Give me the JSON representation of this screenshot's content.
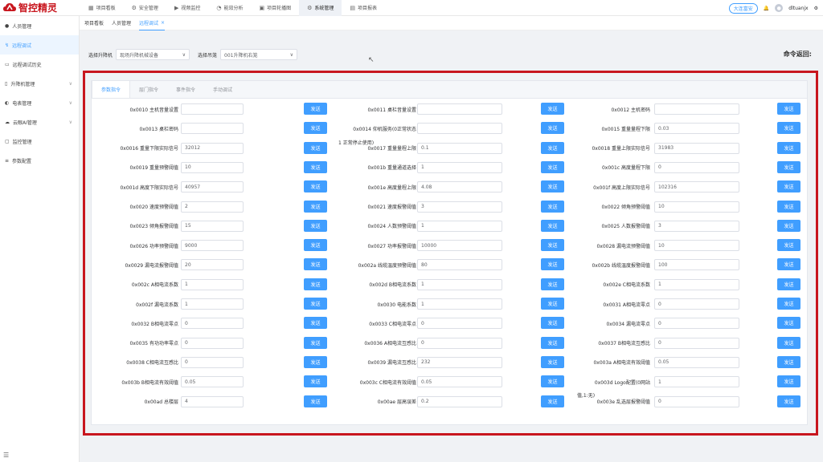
{
  "brand": {
    "name": "智控精灵",
    "color": "#c8161e"
  },
  "topnav": [
    {
      "label": "项目看板",
      "icon": "dashboard-icon"
    },
    {
      "label": "安全管理",
      "icon": "gear-icon"
    },
    {
      "label": "视频监控",
      "icon": "video-icon"
    },
    {
      "label": "能效分析",
      "icon": "chart-icon"
    },
    {
      "label": "项目轮播图",
      "icon": "image-icon"
    },
    {
      "label": "系统管理",
      "icon": "settings-icon",
      "active": true
    },
    {
      "label": "项目报表",
      "icon": "report-icon"
    }
  ],
  "topright": {
    "tenant": "大连富安",
    "user": "dltuanjx"
  },
  "sidebar": [
    {
      "label": "人员管理",
      "icon": "user-icon"
    },
    {
      "label": "远程调试",
      "icon": "remote-icon",
      "active": true
    },
    {
      "label": "远程调试历史",
      "icon": "history-icon"
    },
    {
      "label": "升降机管理",
      "icon": "elevator-icon",
      "chevron": "∨"
    },
    {
      "label": "电表管理",
      "icon": "meter-icon",
      "chevron": "∨"
    },
    {
      "label": "云眼AI管理",
      "icon": "cloud-icon",
      "chevron": "∨"
    },
    {
      "label": "监控管理",
      "icon": "monitor-icon"
    },
    {
      "label": "参数配置",
      "icon": "config-icon"
    }
  ],
  "tabs": [
    {
      "label": "项目看板"
    },
    {
      "label": "人员管理"
    },
    {
      "label": "远程调试",
      "active": true,
      "close": "×"
    }
  ],
  "filter": {
    "elevator_label": "选择升降机",
    "elevator_value": "现场升降机械设备",
    "cage_label": "选择吊笼",
    "cage_value": "001升降机右笼"
  },
  "command_return": "命令返回:",
  "panel_tabs": [
    {
      "label": "参数指令",
      "active": true
    },
    {
      "label": "层门指令"
    },
    {
      "label": "事件指令"
    },
    {
      "label": "手动调试"
    }
  ],
  "send_label": "发送",
  "params": [
    [
      {
        "label": "0x0010 主机音量设置",
        "value": ""
      },
      {
        "label": "0x0011 桌栏音量设置",
        "value": ""
      },
      {
        "label": "0x0012 主机密码",
        "value": ""
      }
    ],
    [
      {
        "label": "0x0013 桌栏密码",
        "value": ""
      },
      {
        "label": "0x0014 仰机服务(0正常状态",
        "value": ""
      },
      {
        "label": "0x0015 重量量程下限",
        "value": "0.03"
      }
    ],
    [
      {
        "label": "0x0016 重量下限实际信号",
        "value": "32012"
      },
      {
        "label": "0x0017 重量量程上限",
        "value": "0.1"
      },
      {
        "label": "0x0018 重量上限实际信号",
        "value": "31983"
      }
    ],
    [
      {
        "label": "0x0019 重量预警阈值",
        "value": "10"
      },
      {
        "label": "0x001b 重量通道选择",
        "value": "1"
      },
      {
        "label": "0x001c 高度量程下限",
        "value": "0"
      }
    ],
    [
      {
        "label": "0x001d 高度下限实际信号",
        "value": "40957"
      },
      {
        "label": "0x001e 高度量程上限",
        "value": "4.08"
      },
      {
        "label": "0x001f 高度上限实际信号",
        "value": "102316"
      }
    ],
    [
      {
        "label": "0x0020 速度预警阈值",
        "value": "2"
      },
      {
        "label": "0x0021 速度报警阈值",
        "value": "3"
      },
      {
        "label": "0x0022 倾角预警阈值",
        "value": "10"
      }
    ],
    [
      {
        "label": "0x0023 倾角报警阈值",
        "value": "15"
      },
      {
        "label": "0x0024 人数预警阈值",
        "value": "1"
      },
      {
        "label": "0x0025 人数报警阈值",
        "value": "3"
      }
    ],
    [
      {
        "label": "0x0026 功率预警阈值",
        "value": "9000"
      },
      {
        "label": "0x0027 功率报警阈值",
        "value": "10000"
      },
      {
        "label": "0x0028 漏电流预警阈值",
        "value": "10"
      }
    ],
    [
      {
        "label": "0x0029 漏电流报警阈值",
        "value": "20"
      },
      {
        "label": "0x002a 线缆温度预警阈值",
        "value": "80"
      },
      {
        "label": "0x002b 线缆温度报警阈值",
        "value": "100"
      }
    ],
    [
      {
        "label": "0x002c A相电流系数",
        "value": "1"
      },
      {
        "label": "0x002d B相电流系数",
        "value": "1"
      },
      {
        "label": "0x002e C相电流系数",
        "value": "1"
      }
    ],
    [
      {
        "label": "0x002f 漏电流系数",
        "value": "1"
      },
      {
        "label": "0x0030 电能系数",
        "value": "1"
      },
      {
        "label": "0x0031 A相电流零点",
        "value": "0"
      }
    ],
    [
      {
        "label": "0x0032 B相电流零点",
        "value": "0"
      },
      {
        "label": "0x0033 C相电流零点",
        "value": "0"
      },
      {
        "label": "0x0034 漏电流零点",
        "value": "0"
      }
    ],
    [
      {
        "label": "0x0035 有功功率零点",
        "value": "0"
      },
      {
        "label": "0x0036 A相电流互感比",
        "value": "0"
      },
      {
        "label": "0x0037 B相电流互感比",
        "value": "0"
      }
    ],
    [
      {
        "label": "0x0038 C相电流互感比",
        "value": "0"
      },
      {
        "label": "0x0039 漏电流互感比",
        "value": "232"
      },
      {
        "label": "0x003a A相电流有效阈值",
        "value": "0.05"
      }
    ],
    [
      {
        "label": "0x003b B相电流有效阈值",
        "value": "0.05"
      },
      {
        "label": "0x003c C相电流有效阈值",
        "value": "0.05"
      },
      {
        "label": "0x003d Logo配置(0网站",
        "value": "1"
      }
    ],
    [
      {
        "label": "0x00ad 总楼层",
        "value": "4"
      },
      {
        "label": "0x00ae 层高误差",
        "value": "0.2"
      },
      {
        "label": "0x003e 乱选层报警阈值",
        "value": "0"
      }
    ]
  ],
  "notes": {
    "n1": "1 正常停止使用)",
    "n2": "值,1:无)"
  }
}
